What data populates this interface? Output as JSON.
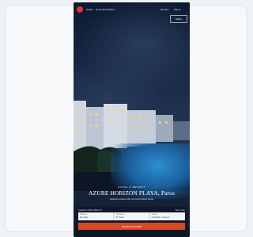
{
  "nav": {
    "links": [
      "Hotels",
      "Destinations",
      "Offers"
    ],
    "right_links": [
      "My trips",
      "Sign in"
    ],
    "menu_label": "Menu"
  },
  "hero": {
    "eyebrow": "HOTEL & RESORT",
    "title": "AZURE HORIZON PLAYA, Paros",
    "subtitle": "Seafront suites with pool and island views"
  },
  "booking": {
    "label": "CHECK AVAILABILITY",
    "right_label": "Best rate",
    "fields": [
      {
        "label": "Check-in",
        "value": "20 June"
      },
      {
        "label": "Check-out",
        "value": "27 June"
      },
      {
        "label": "Guests",
        "value": "2 Adults, 1 Room"
      }
    ],
    "button": "SEARCH ROOMS"
  },
  "colors": {
    "accent": "#d84a23",
    "brand": "#d53b2a"
  }
}
